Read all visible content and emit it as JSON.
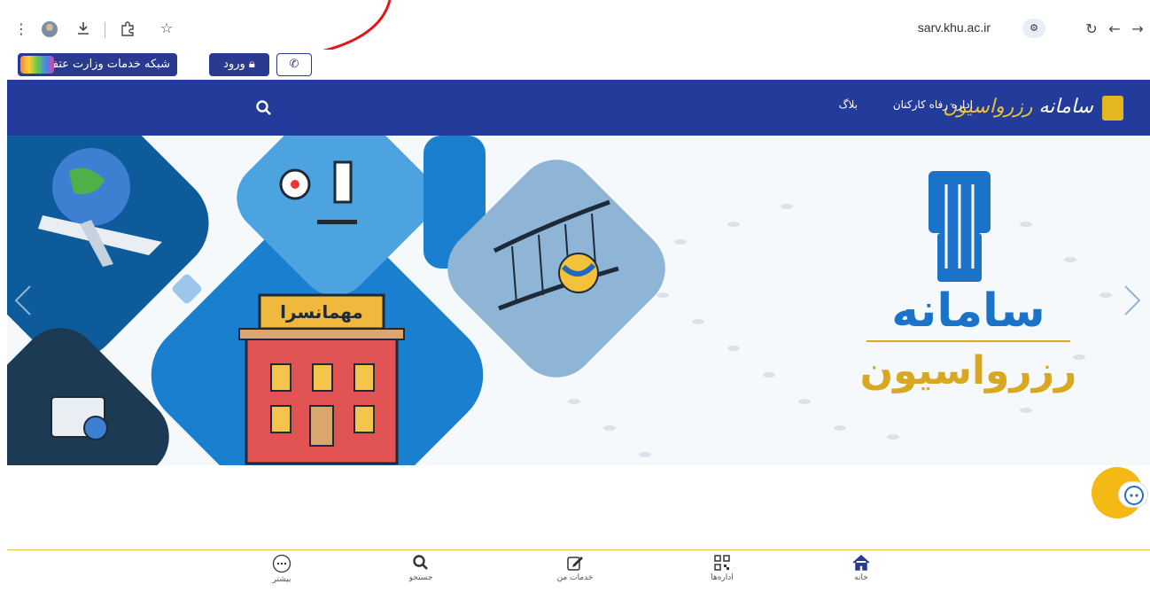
{
  "browser": {
    "url": "sarv.khu.ac.ir",
    "icons": [
      "more-vert-icon",
      "avatar",
      "download-icon",
      "extensions-icon",
      "star-icon",
      "site-settings-icon",
      "reload-icon",
      "back-icon",
      "forward-icon"
    ]
  },
  "topbar": {
    "network_label": "شبکه خدمات وزارت عتف",
    "login_label": "ورود",
    "phone_icon": "phone-icon"
  },
  "header": {
    "logo_text_a": "سامانه",
    "logo_text_b": "رزرواسیون",
    "nav_items": [
      "اداره رفاه کارکنان",
      "بلاگ"
    ],
    "colors": {
      "header_bg": "#233b9b",
      "accent_gold": "#e8c23a"
    }
  },
  "hero": {
    "title_line1": "سامانه",
    "title_line2": "رزرواسیون",
    "sign_text": "مهمانسرا"
  },
  "bottom_nav": {
    "items": [
      {
        "label": "خانه",
        "icon": "home-icon"
      },
      {
        "label": "اداره‌ها",
        "icon": "qr-icon"
      },
      {
        "label": "خدمات من",
        "icon": "edit-icon"
      },
      {
        "label": "جستجو",
        "icon": "search-icon"
      },
      {
        "label": "بیشتر",
        "icon": "more-icon"
      }
    ]
  }
}
